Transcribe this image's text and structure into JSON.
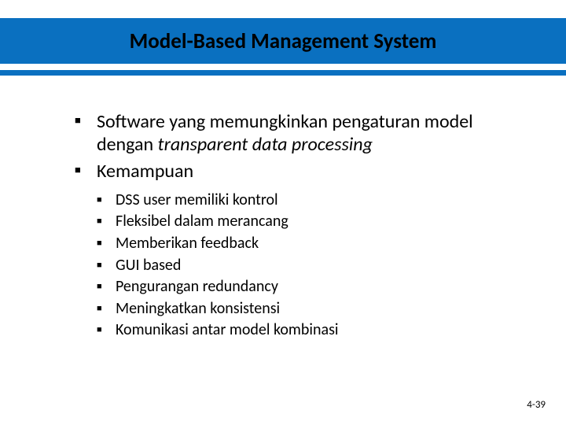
{
  "title": "Model-Based Management System",
  "bullets": [
    {
      "runs": [
        {
          "t": "Software yang memungkinkan pengaturan model dengan  "
        },
        {
          "t": "transparent data processing",
          "italic": true
        }
      ]
    },
    {
      "runs": [
        {
          "t": "Kemampuan"
        }
      ],
      "sub": [
        "DSS user memiliki kontrol",
        "Fleksibel dalam merancang",
        "Memberikan feedback",
        "GUI based",
        "Pengurangan redundancy",
        "Meningkatkan konsistensi",
        "Komunikasi antar model kombinasi"
      ]
    }
  ],
  "footer": "4-39"
}
